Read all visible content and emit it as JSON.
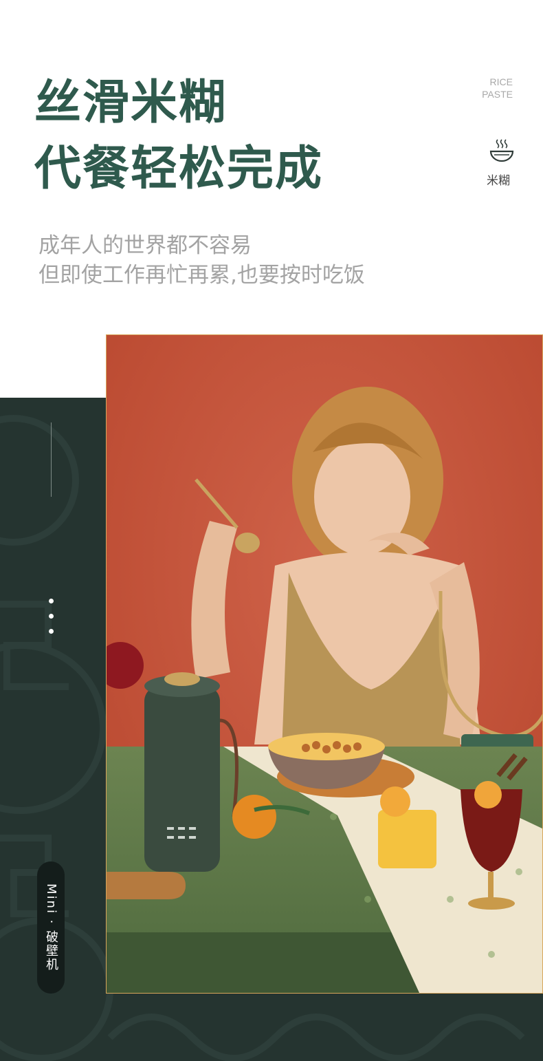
{
  "headline": {
    "line1": "丝滑米糊",
    "line2": "代餐轻松完成"
  },
  "tag": {
    "en_line1": "RICE",
    "en_line2": "PASTE",
    "icon": "steaming-bowl-icon",
    "label": "米糊"
  },
  "subtext": {
    "line1": "成年人的世界都不容易",
    "line2": "但即使工作再忙再累,也要按时吃饭"
  },
  "side_label": "Mini · 破壁机",
  "colors": {
    "headline": "#2f5a4d",
    "panel": "#253430",
    "photo_frame": "#d8a65b",
    "photo_wall": "#c6543d",
    "table": "#5f7a48"
  }
}
